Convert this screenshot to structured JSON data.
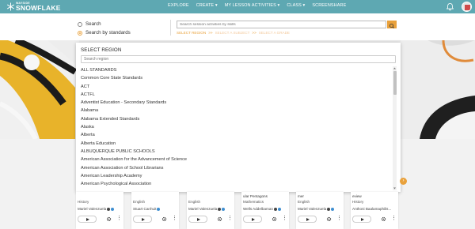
{
  "app": {
    "brand_small": "WAYSIDE",
    "brand": "SNOWFLAKE",
    "colors": {
      "nav": "#5ea8b2",
      "accent": "#e9a13b"
    }
  },
  "nav": {
    "items": [
      "EXPLORE",
      "CREATE ▾",
      "MY LESSON ACTIVITIES ▾",
      "CLASS ▾",
      "SCREENSHARE"
    ],
    "bell_icon": "bell-icon",
    "avatar_icon": "user-avatar"
  },
  "search": {
    "option_search": "Search",
    "option_standards": "Search by standards",
    "placeholder": "Search session activities by skills",
    "button_icon": "search-icon",
    "breadcrumb": {
      "step1": "SELECT REGION",
      "sep": ">>",
      "step2": "SELECT A SUBJECT",
      "step3": "SELECT A GRADE"
    }
  },
  "modal": {
    "title": "SELECT REGION",
    "search_placeholder": "Search region",
    "regions": [
      "ALL STANDARDS",
      "Common Core State Standards",
      "ACT",
      "ACTFL",
      "Adventist Education - Secondary Standards",
      "Alabama",
      "Alabama Extended Standards",
      "Alaska",
      "Alberta",
      "Alberta Education",
      "ALBUQUERQUE PUBLIC SCHOOLS",
      "American Association for the Advancement of Science",
      "American Association of School Librarians",
      "American Leadership Academy",
      "American Psychological Association"
    ]
  },
  "cards": [
    {
      "title": "",
      "subject": "History",
      "author": "Mariel Valenzuela"
    },
    {
      "title": "",
      "subject": "English",
      "author": "Stuart Canhuit"
    },
    {
      "title": "",
      "subject": "English",
      "author": "Mariel Valenzuela"
    },
    {
      "title": "ular Pentagons",
      "subject": "Mathematics",
      "author": "Wells Addelbaman"
    },
    {
      "title": "mer",
      "subject": "English",
      "author": "Mariel Valenzuela"
    },
    {
      "title": "eview",
      "subject": "History",
      "author": "Anthoni Baalamaphilis..."
    }
  ]
}
